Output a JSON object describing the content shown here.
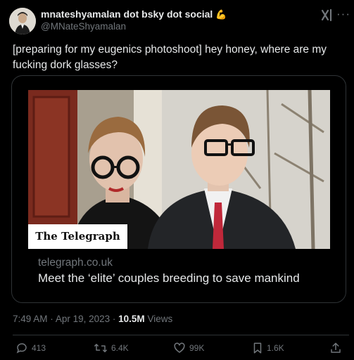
{
  "author": {
    "display_name": "mnateshyamalan dot bsky dot social",
    "emoji": "💪",
    "handle": "@MNateShyamalan"
  },
  "tweet": {
    "text": "[preparing for my eugenics photoshoot] hey honey, where are my fucking dork glasses?"
  },
  "card": {
    "image_badge": "The Telegraph",
    "domain": "telegraph.co.uk",
    "headline": "Meet the ‘elite’ couples breeding to save mankind"
  },
  "meta": {
    "time": "7:49 AM",
    "date": "Apr 19, 2023",
    "views_count": "10.5M",
    "views_label": "Views"
  },
  "actions": {
    "replies": "413",
    "reposts": "6.4K",
    "likes": "99K",
    "bookmarks": "1.6K"
  },
  "icons": [
    "grok-icon",
    "more-icon",
    "reply-icon",
    "repost-icon",
    "like-icon",
    "bookmark-icon",
    "share-icon"
  ],
  "colors": {
    "background": "#000000",
    "text": "#e7e9ea",
    "secondary": "#71767b",
    "border": "#2f3336"
  }
}
